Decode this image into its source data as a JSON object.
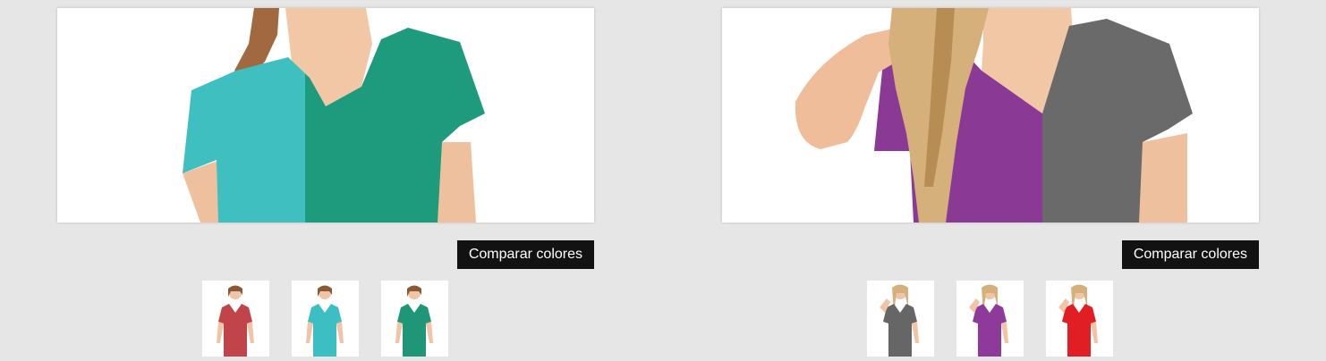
{
  "products": [
    {
      "compare_button_label": "Comparar colores",
      "split_colors": [
        "#3fbfbf",
        "#1e9a7c"
      ],
      "thumbnails": [
        {
          "color": "#c0444a",
          "hair": "brown"
        },
        {
          "color": "#3cbec3",
          "hair": "brown"
        },
        {
          "color": "#1e9677",
          "hair": "brown"
        }
      ]
    },
    {
      "compare_button_label": "Comparar colores",
      "split_colors": [
        "#8a3a94",
        "#6a6a6a"
      ],
      "thumbnails": [
        {
          "color": "#666666",
          "hair": "blonde"
        },
        {
          "color": "#8e3a9a",
          "hair": "blonde"
        },
        {
          "color": "#e01e24",
          "hair": "blonde"
        }
      ]
    }
  ]
}
